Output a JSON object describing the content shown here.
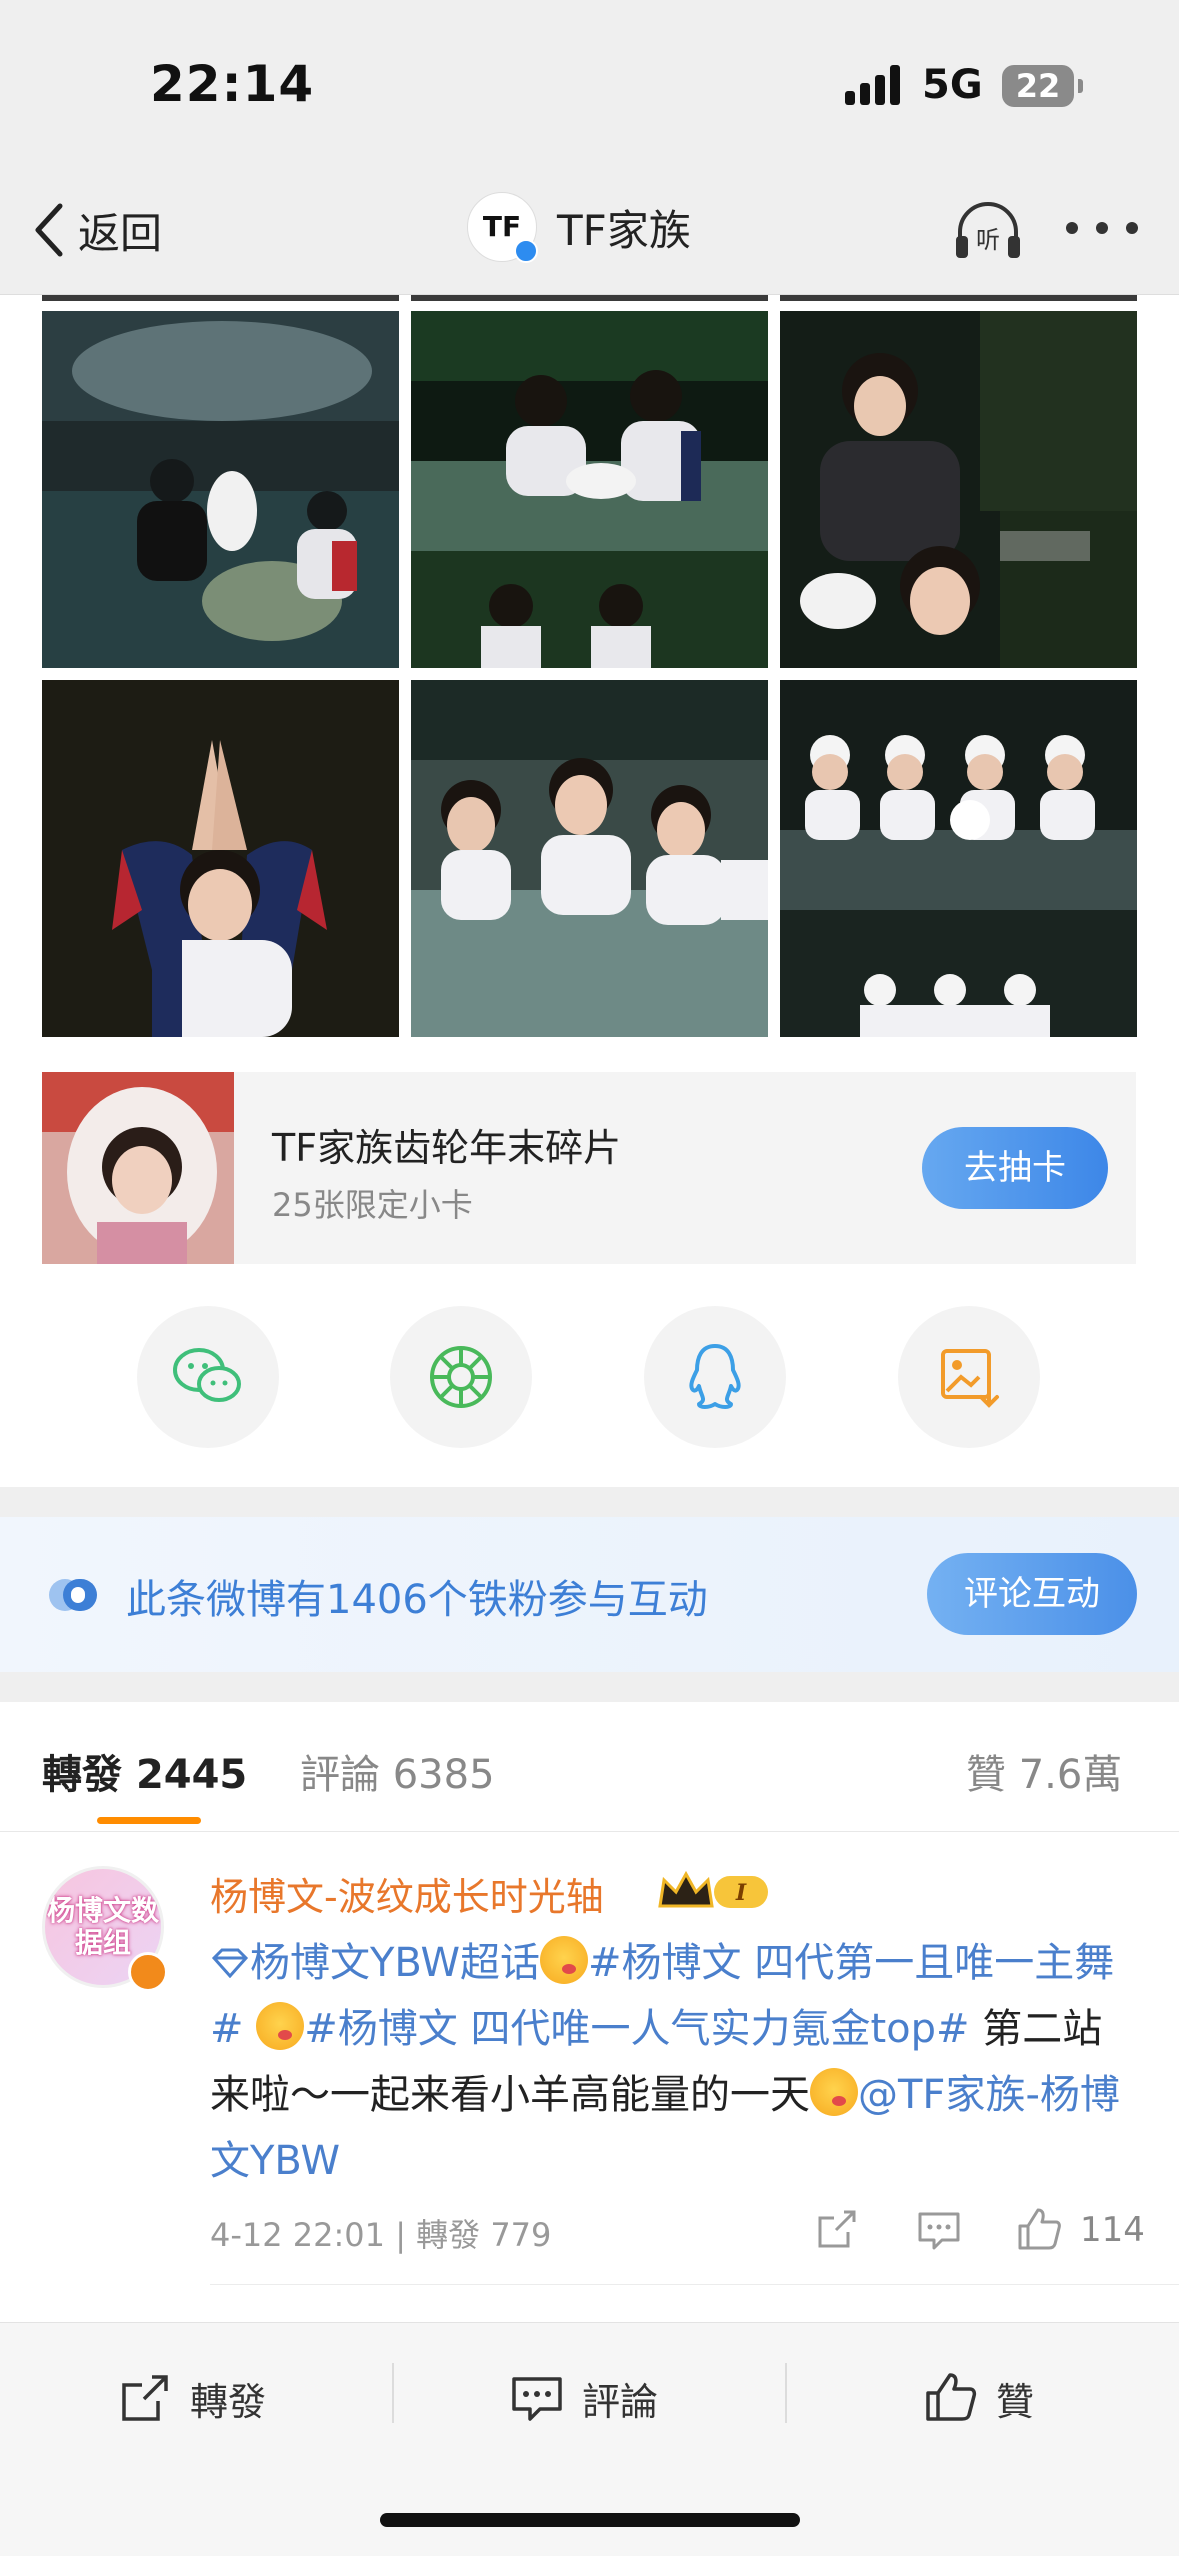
{
  "status_bar": {
    "time": "22:14",
    "network": "5G",
    "battery": "22"
  },
  "nav": {
    "back_label": "返回",
    "title": "TF家族",
    "avatar_text": "TF"
  },
  "promo": {
    "title": "TF家族齿轮年末碎片",
    "subtitle": "25张限定小卡",
    "button": "去抽卡"
  },
  "share_icons": [
    "wechat-icon",
    "moments-icon",
    "qq-icon",
    "save-image-icon"
  ],
  "fans_banner": {
    "text": "此条微博有1406个铁粉参与互动",
    "button": "评论互动"
  },
  "tabs": {
    "repost_label": "轉發",
    "repost_count": "2445",
    "comment_label": "評論",
    "comment_count": "6385",
    "like_label": "贊",
    "like_count": "7.6萬"
  },
  "comment": {
    "avatar_text": "杨博文数据组",
    "user": "杨博文-波纹成长时光轴",
    "badge": "I",
    "topic_1": "杨博文YBW超话",
    "topic_2": "#杨博文 四代第一且唯一主舞#",
    "topic_3": "#杨博文 四代唯一人气实力氪金top#",
    "text": " 第二站来啦～一起来看小羊高能量的一天",
    "mention": "@TF家族-杨博文YBW",
    "meta": "4-12 22:01 | 轉發 779",
    "likes": "114"
  },
  "bottom_bar": {
    "repost": "轉發",
    "comment": "評論",
    "like": "贊"
  }
}
